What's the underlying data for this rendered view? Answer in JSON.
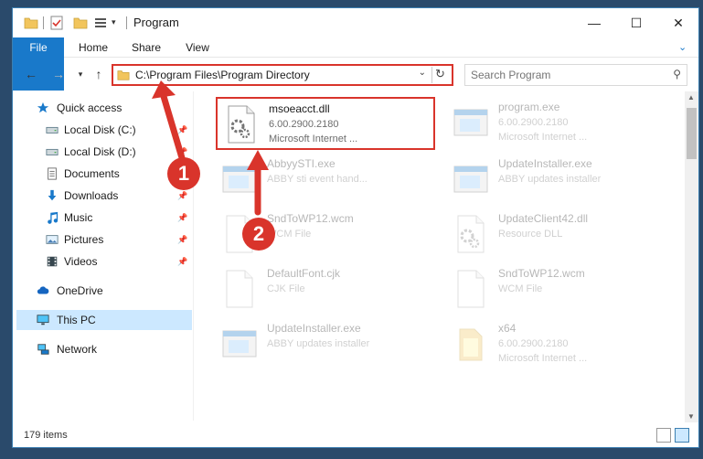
{
  "window": {
    "title": "Program"
  },
  "window_controls": {
    "minimize": "—",
    "maximize": "☐",
    "close": "✕"
  },
  "ribbon": {
    "tabs": [
      "File",
      "Home",
      "Share",
      "View"
    ]
  },
  "address_bar": {
    "path": "C:\\Program Files\\Program Directory"
  },
  "search": {
    "placeholder": "Search Program"
  },
  "sidebar": {
    "items": [
      {
        "label": "Quick access",
        "icon": "star-icon"
      },
      {
        "label": "Local Disk (C:)",
        "icon": "drive-icon",
        "pinned": true
      },
      {
        "label": "Local Disk (D:)",
        "icon": "drive-icon",
        "pinned": true
      },
      {
        "label": "Documents",
        "icon": "documents-icon",
        "pinned": true
      },
      {
        "label": "Downloads",
        "icon": "download-icon",
        "pinned": true
      },
      {
        "label": "Music",
        "icon": "music-icon",
        "pinned": true
      },
      {
        "label": "Pictures",
        "icon": "pictures-icon",
        "pinned": true
      },
      {
        "label": "Videos",
        "icon": "videos-icon",
        "pinned": true
      },
      {
        "label": "OneDrive",
        "icon": "cloud-icon"
      },
      {
        "label": "This PC",
        "icon": "computer-icon",
        "selected": true
      },
      {
        "label": "Network",
        "icon": "network-icon"
      }
    ]
  },
  "files": [
    {
      "name": "msoeacct.dll",
      "line2": "6.00.2900.2180",
      "line3": "Microsoft Internet ...",
      "icon": "dll-gear-icon",
      "highlighted": true
    },
    {
      "name": "program.exe",
      "line2": "6.00.2900.2180",
      "line3": "Microsoft Internet ...",
      "icon": "exe-icon"
    },
    {
      "name": "AbbyySTI.exe",
      "line2": "ABBY sti event hand...",
      "line3": "",
      "icon": "exe-icon"
    },
    {
      "name": "UpdateInstaller.exe",
      "line2": "ABBY updates installer",
      "line3": "",
      "icon": "exe-icon"
    },
    {
      "name": "SndToWP12.wcm",
      "line2": "WCM File",
      "line3": "",
      "icon": "file-icon"
    },
    {
      "name": "UpdateClient42.dll",
      "line2": "Resource DLL",
      "line3": "",
      "icon": "dll-gear-icon"
    },
    {
      "name": "DefaultFont.cjk",
      "line2": "CJK File",
      "line3": "",
      "icon": "file-icon"
    },
    {
      "name": "SndToWP12.wcm",
      "line2": "WCM File",
      "line3": "",
      "icon": "file-icon"
    },
    {
      "name": "UpdateInstaller.exe",
      "line2": "ABBY updates installer",
      "line3": "",
      "icon": "exe-icon"
    },
    {
      "name": "x64",
      "line2": "6.00.2900.2180",
      "line3": "Microsoft Internet ...",
      "icon": "folder-icon"
    }
  ],
  "status": {
    "item_count": "179 items"
  },
  "annotations": {
    "callout_1": "1",
    "callout_2": "2"
  },
  "colors": {
    "accent": "#1979ca",
    "highlight": "#d9342b",
    "selected_bg": "#cce8ff"
  }
}
